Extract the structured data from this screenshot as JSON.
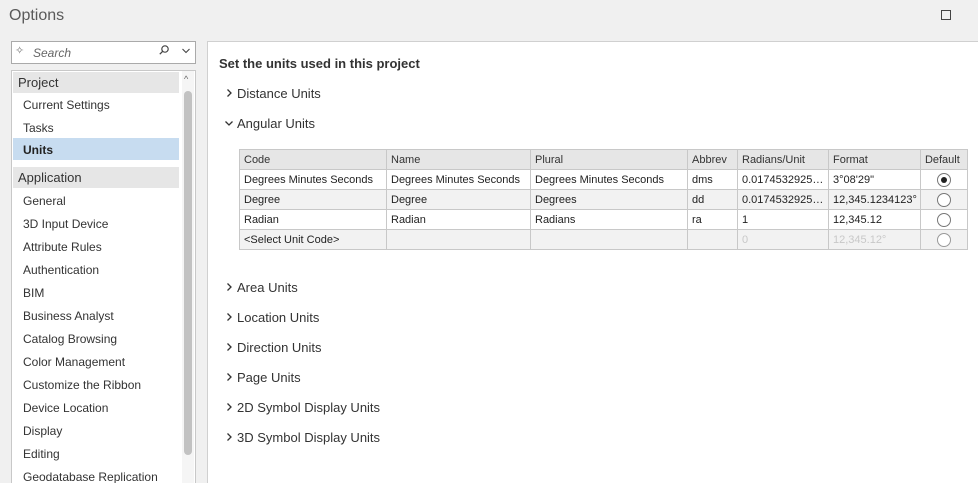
{
  "window": {
    "title": "Options"
  },
  "search": {
    "placeholder": "Search"
  },
  "nav": {
    "groups": [
      {
        "label": "Project",
        "items": [
          "Current Settings",
          "Tasks",
          "Units"
        ]
      },
      {
        "label": "Application",
        "items": [
          "General",
          "3D Input Device",
          "Attribute Rules",
          "Authentication",
          "BIM",
          "Business Analyst",
          "Catalog Browsing",
          "Color Management",
          "Customize the Ribbon",
          "Device Location",
          "Display",
          "Editing",
          "Geodatabase Replication"
        ]
      }
    ],
    "selected": "Units"
  },
  "main": {
    "heading": "Set the units used in this project",
    "sections": [
      {
        "label": "Distance Units",
        "expanded": false
      },
      {
        "label": "Angular Units",
        "expanded": true
      },
      {
        "label": "Area Units",
        "expanded": false
      },
      {
        "label": "Location Units",
        "expanded": false
      },
      {
        "label": "Direction Units",
        "expanded": false
      },
      {
        "label": "Page Units",
        "expanded": false
      },
      {
        "label": "2D Symbol Display Units",
        "expanded": false
      },
      {
        "label": "3D Symbol Display Units",
        "expanded": false
      }
    ],
    "angular_table": {
      "columns": [
        "Code",
        "Name",
        "Plural",
        "Abbrev",
        "Radians/Unit",
        "Format",
        "Default"
      ],
      "rows": [
        {
          "code": "Degrees Minutes Seconds",
          "name": "Degrees Minutes Seconds",
          "plural": "Degrees Minutes Seconds",
          "abbrev": "dms",
          "radians": "0.0174532925…",
          "format": "3°08'29\"",
          "default": true
        },
        {
          "code": "Degree",
          "name": "Degree",
          "plural": "Degrees",
          "abbrev": "dd",
          "radians": "0.0174532925…",
          "format": "12,345.1234123°",
          "default": false
        },
        {
          "code": "Radian",
          "name": "Radian",
          "plural": "Radians",
          "abbrev": "ra",
          "radians": "1",
          "format": "12,345.12",
          "default": false
        },
        {
          "code": "<Select Unit Code>",
          "name": "",
          "plural": "",
          "abbrev": "",
          "radians": "0",
          "format": "12,345.12°",
          "default": false
        }
      ]
    }
  }
}
